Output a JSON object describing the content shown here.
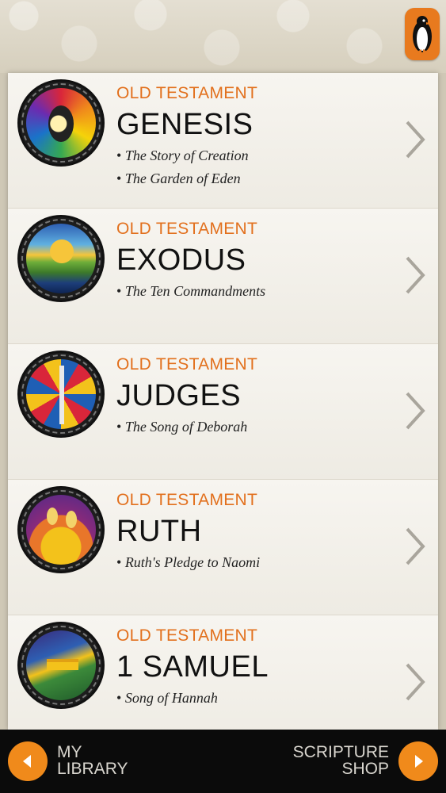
{
  "books": [
    {
      "category": "OLD TESTAMENT",
      "title": "GENESIS",
      "stories": [
        "The Story of Creation",
        "The Garden of Eden"
      ]
    },
    {
      "category": "OLD TESTAMENT",
      "title": "EXODUS",
      "stories": [
        "The Ten Commandments"
      ]
    },
    {
      "category": "OLD TESTAMENT",
      "title": "JUDGES",
      "stories": [
        "The Song of Deborah"
      ]
    },
    {
      "category": "OLD TESTAMENT",
      "title": "RUTH",
      "stories": [
        "Ruth's Pledge to Naomi"
      ]
    },
    {
      "category": "OLD TESTAMENT",
      "title": "1 SAMUEL",
      "stories": [
        "Song of Hannah"
      ]
    }
  ],
  "bottom_bar": {
    "left_line1": "MY",
    "left_line2": "LIBRARY",
    "right_line1": "SCRIPTURE",
    "right_line2": "SHOP"
  },
  "colors": {
    "accent": "#e2701d",
    "button": "#f08a1b",
    "bar": "#0b0b0b"
  }
}
